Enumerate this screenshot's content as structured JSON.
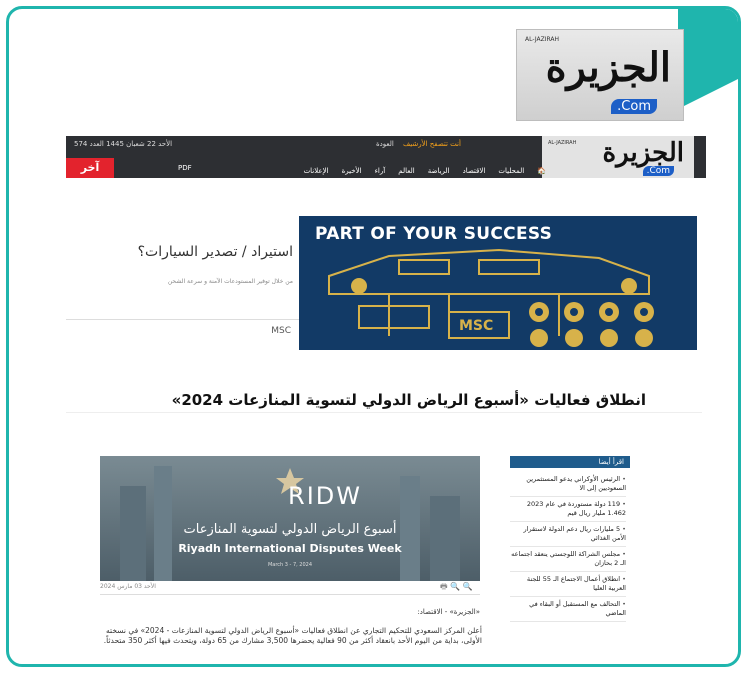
{
  "top_logo": {
    "arabic": "الجزيرة",
    "com": ".Com",
    "small": "AL-JAZIRAH"
  },
  "site": {
    "topbar_date": "الأحد 22 شعبان 1445 العدد 574",
    "follow": "أنت تتصفح الأرشيف",
    "back": "العودة",
    "logo_arabic": "الجزيرة",
    "logo_com": ".Com",
    "logo_small": "AL-JAZIRAH",
    "nav_items": [
      "🏠",
      "المحليات",
      "الاقتصاد",
      "الرياضة",
      "العالم",
      "آراء",
      "الأخيرة",
      "الإعلانات"
    ],
    "pdf_label": "PDF",
    "latest_label": "آخر الأخبار"
  },
  "ad": {
    "question": "استيراد / تصدير السيارات؟",
    "subtext": "من خلال توفير المستودعات الآمنة و سرعة الشحن",
    "brand": "MSC",
    "banner_headline": "PART OF YOUR SUCCESS"
  },
  "article": {
    "title": "انطلاق فعاليات «أسبوع الرياض الدولي لتسوية المنازعات 2024»",
    "hero_logo": "RIDW",
    "hero_arabic": "أسبوع الرياض الدولي لتسوية المنازعات",
    "hero_english": "Riyadh International Disputes Week",
    "hero_dates": "March 3 - 7, 2024",
    "date": "الأحد 03 مارس 2024",
    "icons": "🖶 🔍 🔍",
    "byline": "«الجزيرة» - الاقتصاد:",
    "body": "أعلن المركز السعودي للتحكيم التجاري عن انطلاق فعاليات «أسبوع الرياض الدولي لتسوية المنازعات - 2024» في نسخته الأولى، بداية من اليوم الأحد بانعقاد أكثر من 90 فعالية يحضرها 3,500 مشارك من 65 دولة، ويتحدث فيها أكثر 350 متحدثاً."
  },
  "sidebar": {
    "heading": "اقرأ أيضا",
    "items": [
      "الرئيس الأوكراني يدعو المستثمرين السعوديين إلى الا",
      "119 دولة مستوردة في عام 2023 1.462 مليار ريال قيم",
      "5 مليارات ريال دعم الدولة لاستقرار الأمن الغذائي",
      "مجلس الشراكة اللوجستي ينعقد اجتماعه الـ 2 بحازان",
      "انطلاق أعمال الاجتماع الـ 55 للجنة العربية العليا",
      "التحالف مع المستقبل أو البقاء في الماضي"
    ]
  },
  "colors": {
    "frame": "#1fb5ad",
    "topbar": "#2d2f33",
    "latest": "#e3232d",
    "banner": "#123a66",
    "sidebar_head": "#1f5c8c"
  }
}
